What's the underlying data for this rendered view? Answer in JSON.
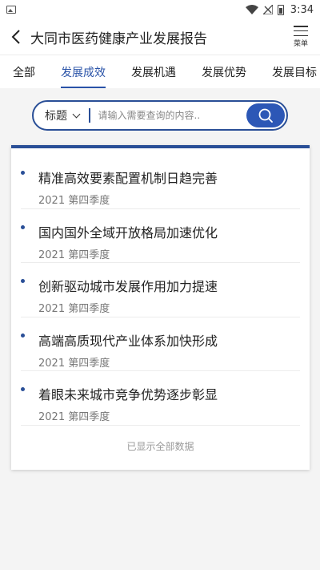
{
  "status_bar": {
    "time": "3:34"
  },
  "header": {
    "title": "大同市医药健康产业发展报告",
    "menu_label": "菜单"
  },
  "tabs": [
    {
      "label": "全部",
      "active": false
    },
    {
      "label": "发展成效",
      "active": true
    },
    {
      "label": "发展机遇",
      "active": false
    },
    {
      "label": "发展优势",
      "active": false
    },
    {
      "label": "发展目标",
      "active": false
    }
  ],
  "search": {
    "field_select": "标题",
    "placeholder": "请输入需要查询的内容.."
  },
  "list": [
    {
      "title": "精准高效要素配置机制日趋完善",
      "date": "2021 第四季度"
    },
    {
      "title": "国内国外全域开放格局加速优化",
      "date": "2021 第四季度"
    },
    {
      "title": "创新驱动城市发展作用加力提速",
      "date": "2021 第四季度"
    },
    {
      "title": "高端高质现代产业体系加快形成",
      "date": "2021 第四季度"
    },
    {
      "title": "着眼未来城市竞争优势逐步彰显",
      "date": "2021 第四季度"
    }
  ],
  "footer_note": "已显示全部数据",
  "colors": {
    "accent": "#2a53a8",
    "search_button": "#2c57b6"
  }
}
